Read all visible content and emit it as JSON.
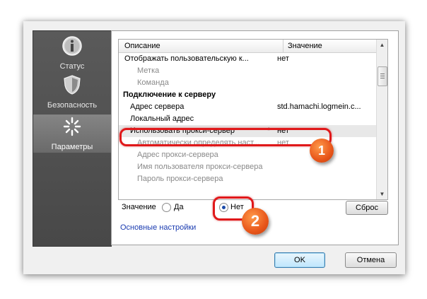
{
  "sidebar": {
    "items": [
      {
        "label": "Статус",
        "icon": "info-icon"
      },
      {
        "label": "Безопасность",
        "icon": "shield-icon"
      },
      {
        "label": "Параметры",
        "icon": "settings-sparkle-icon"
      }
    ]
  },
  "list": {
    "col_description": "Описание",
    "col_value": "Значение",
    "rows": [
      {
        "desc": "Отображать пользовательскую к...",
        "value": "нет"
      },
      {
        "desc": "Метка",
        "value": ""
      },
      {
        "desc": "Команда",
        "value": ""
      },
      {
        "desc": "Подключение к серверу",
        "value": ""
      },
      {
        "desc": "Адрес сервера",
        "value": "std.hamachi.logmein.c..."
      },
      {
        "desc": "Локальный адрес",
        "value": ""
      },
      {
        "desc": "Использовать прокси-сервер",
        "mark": "*",
        "value": "нет"
      },
      {
        "desc": "Автоматически определять наст...",
        "value": "нет"
      },
      {
        "desc": "Адрес прокси-сервера",
        "value": ""
      },
      {
        "desc": "Имя пользователя прокси-сервера",
        "value": ""
      },
      {
        "desc": "Пароль прокси-сервера",
        "value": ""
      }
    ]
  },
  "value_area": {
    "label": "Значение",
    "option_yes": "Да",
    "option_no": "Нет",
    "selected": "Нет",
    "reset_button": "Сброс"
  },
  "link_basic_settings": "Основные настройки",
  "footer": {
    "ok": "OK",
    "cancel": "Отмена"
  },
  "annotations": {
    "badge1": "1",
    "badge2": "2"
  },
  "colors": {
    "callout": "#e0181a",
    "badge": "#e8561a"
  }
}
